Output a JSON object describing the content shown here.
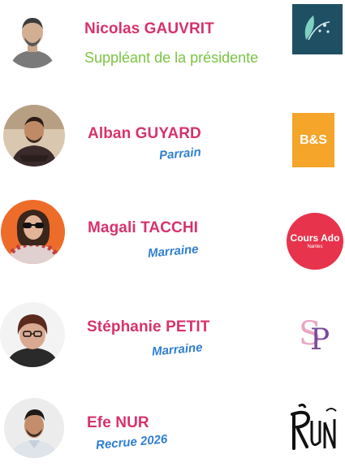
{
  "people": [
    {
      "name": "Nicolas GAUVRIT",
      "role": "Suppléant de la présidente",
      "logo": {
        "type": "leaf-emblem",
        "bg": "#1f4f63",
        "accent": "#7fd0c0"
      }
    },
    {
      "name": "Alban GUYARD",
      "role": "Parrain",
      "logo": {
        "type": "text-badge",
        "text": "B&S",
        "bg": "#f4a52a"
      }
    },
    {
      "name": "Magali TACCHI",
      "role": "Marraine",
      "logo": {
        "type": "circle-badge",
        "text": "Cours Ado",
        "sub": "Nantes",
        "bg": "#e8334d"
      }
    },
    {
      "name": "Stéphanie PETIT",
      "role": "Marraine",
      "logo": {
        "type": "monogram",
        "text": "SP"
      }
    },
    {
      "name": "Efe NUR",
      "role": "Recrue 2026",
      "logo": {
        "type": "monogram-dark",
        "text": "RUN"
      }
    }
  ],
  "colors": {
    "name": "#d6336c",
    "role_blue": "#2f7fd0",
    "role_green": "#7cc443"
  }
}
